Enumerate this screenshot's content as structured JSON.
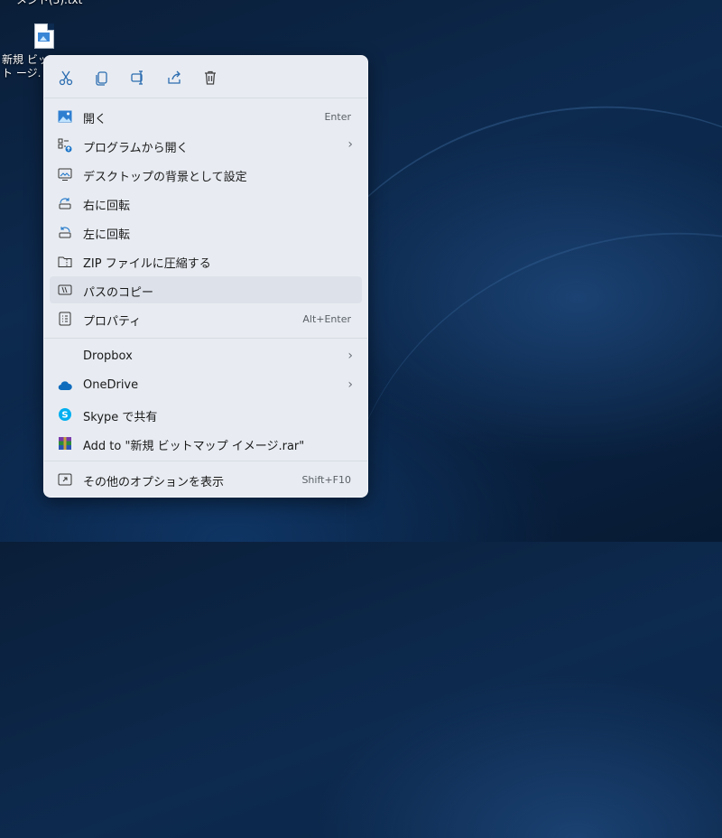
{
  "desktop": {
    "top_file_label": "メント(3).txt",
    "icon_label": "新規 ビット ージ."
  },
  "toolbar": {
    "icons": [
      "cut-icon",
      "copy-icon",
      "rename-icon",
      "share-icon",
      "delete-icon"
    ]
  },
  "menu": {
    "items": [
      {
        "label": "開く",
        "shortcut": "Enter",
        "icon": "photo-icon"
      },
      {
        "label": "プログラムから開く",
        "submenu": true,
        "icon": "open-with-icon"
      },
      {
        "label": "デスクトップの背景として設定",
        "icon": "desktop-background-icon"
      },
      {
        "label": "右に回転",
        "icon": "rotate-right-icon"
      },
      {
        "label": "左に回転",
        "icon": "rotate-left-icon"
      },
      {
        "label": "ZIP ファイルに圧縮する",
        "icon": "zip-icon"
      },
      {
        "label": "パスのコピー",
        "icon": "copy-path-icon",
        "highlighted": true
      },
      {
        "label": "プロパティ",
        "shortcut": "Alt+Enter",
        "icon": "properties-icon"
      },
      {
        "label": "Dropbox",
        "submenu": true,
        "icon": "dropbox-icon"
      },
      {
        "label": "OneDrive",
        "submenu": true,
        "icon": "onedrive-icon"
      },
      {
        "label": "Skype で共有",
        "icon": "skype-icon"
      },
      {
        "label": "Add to \"新規 ビットマップ イメージ.rar\"",
        "icon": "winrar-icon"
      },
      {
        "label": "その他のオプションを表示",
        "shortcut": "Shift+F10",
        "icon": "more-options-icon"
      }
    ]
  },
  "colors": {
    "menu_bg": "#e8ecf2",
    "accent": "#1a73c8",
    "skype": "#00aff0",
    "onedrive": "#0f6cbd"
  }
}
